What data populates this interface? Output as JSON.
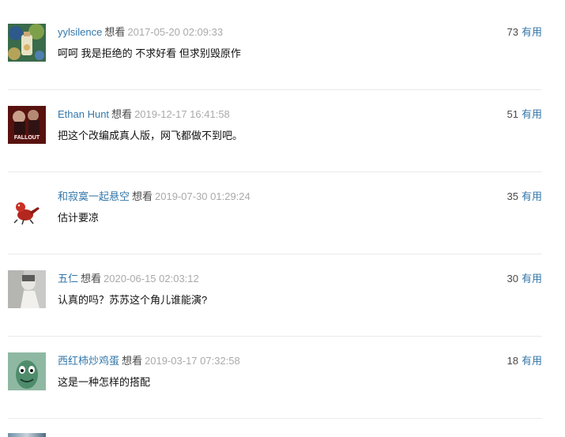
{
  "comments": [
    {
      "user": "yylsilence",
      "status": "想看",
      "time": "2017-05-20 02:09:33",
      "votes": "73",
      "vote_label": "有用",
      "text": "呵呵 我是拒绝的 不求好看 但求别毁原作"
    },
    {
      "user": "Ethan Hunt",
      "status": "想看",
      "time": "2019-12-17 16:41:58",
      "votes": "51",
      "vote_label": "有用",
      "text": "把这个改编成真人版，网飞都做不到吧。"
    },
    {
      "user": "和寂寞一起悬空",
      "status": "想看",
      "time": "2019-07-30 01:29:24",
      "votes": "35",
      "vote_label": "有用",
      "text": "估计要凉"
    },
    {
      "user": "五仁",
      "status": "想看",
      "time": "2020-06-15 02:03:12",
      "votes": "30",
      "vote_label": "有用",
      "text": "认真的吗？苏苏这个角儿谁能演?"
    },
    {
      "user": "西红柿炒鸡蛋",
      "status": "想看",
      "time": "2019-03-17 07:32:58",
      "votes": "18",
      "vote_label": "有用",
      "text": "这是一种怎样的搭配"
    }
  ],
  "poster_text": "FALLOUT"
}
